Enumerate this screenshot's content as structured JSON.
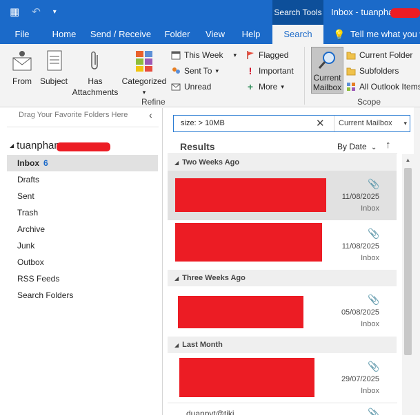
{
  "titlebar": {
    "context_tab": "Search Tools",
    "window_title": "Inbox - tuanphan"
  },
  "tabs": [
    "File",
    "Home",
    "Send / Receive",
    "Folder",
    "View",
    "Help",
    "Search",
    "Tell me what you w"
  ],
  "ribbon": {
    "from": "From",
    "subject": "Subject",
    "has_attachments_1": "Has",
    "has_attachments_2": "Attachments",
    "categorized": "Categorized",
    "this_week": "This Week",
    "sent_to": "Sent To",
    "unread": "Unread",
    "flagged": "Flagged",
    "important": "Important",
    "more": "More",
    "refine_label": "Refine",
    "current_mailbox_1": "Current",
    "current_mailbox_2": "Mailbox",
    "current_folder": "Current Folder",
    "subfolders": "Subfolders",
    "all_outlook_items": "All Outlook Items",
    "scope_label": "Scope"
  },
  "folder_pane": {
    "drag_hint": "Drag Your Favorite Folders Here",
    "account": "tuanphan",
    "folders": [
      {
        "name": "Inbox",
        "count": "6"
      },
      {
        "name": "Drafts"
      },
      {
        "name": "Sent"
      },
      {
        "name": "Trash"
      },
      {
        "name": "Archive"
      },
      {
        "name": "Junk"
      },
      {
        "name": "Outbox"
      },
      {
        "name": "RSS Feeds"
      },
      {
        "name": "Search Folders"
      }
    ]
  },
  "search": {
    "query": "size: > 10MB",
    "scope": "Current Mailbox"
  },
  "results": {
    "title": "Results",
    "sort": "By Date",
    "groups": [
      {
        "label": "Two Weeks Ago"
      },
      {
        "label": "Three Weeks Ago"
      },
      {
        "label": "Last Month"
      }
    ],
    "messages": [
      {
        "date": "11/08/2025",
        "folder": "Inbox"
      },
      {
        "date": "11/08/2025",
        "folder": "Inbox"
      },
      {
        "date": "05/08/2025",
        "folder": "Inbox"
      },
      {
        "date": "29/07/2025",
        "folder": "Inbox"
      }
    ],
    "partial_sender": "duanpvt@tiki"
  },
  "colors": {
    "brand": "#1b6ac9",
    "redaction": "#ec1c24",
    "selected_row": "#e1e1e1"
  }
}
